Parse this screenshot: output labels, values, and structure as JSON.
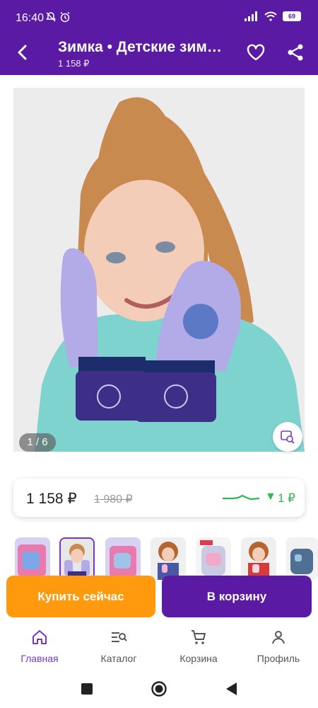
{
  "status_bar": {
    "time": "16:40",
    "battery": "69"
  },
  "header": {
    "title": "Зимка • Детские зим…",
    "subtitle": "1 158 ₽"
  },
  "gallery": {
    "counter": "1 / 6"
  },
  "price": {
    "current": "1 158 ₽",
    "old": "1 980 ₽",
    "drop": "1 ₽",
    "trend_color": "#2bbd4a"
  },
  "actions": {
    "buy_now": "Купить сейчас",
    "add_to_cart": "В корзину"
  },
  "bottom_nav": [
    {
      "label": "Главная",
      "icon": "home-icon",
      "active": true
    },
    {
      "label": "Каталог",
      "icon": "catalog-search-icon",
      "active": false
    },
    {
      "label": "Корзина",
      "icon": "cart-icon",
      "active": false
    },
    {
      "label": "Профиль",
      "icon": "profile-icon",
      "active": false
    }
  ],
  "colors": {
    "brand": "#5a1aa3",
    "accent": "#ff9a0e",
    "active_nav": "#7a36c9"
  }
}
